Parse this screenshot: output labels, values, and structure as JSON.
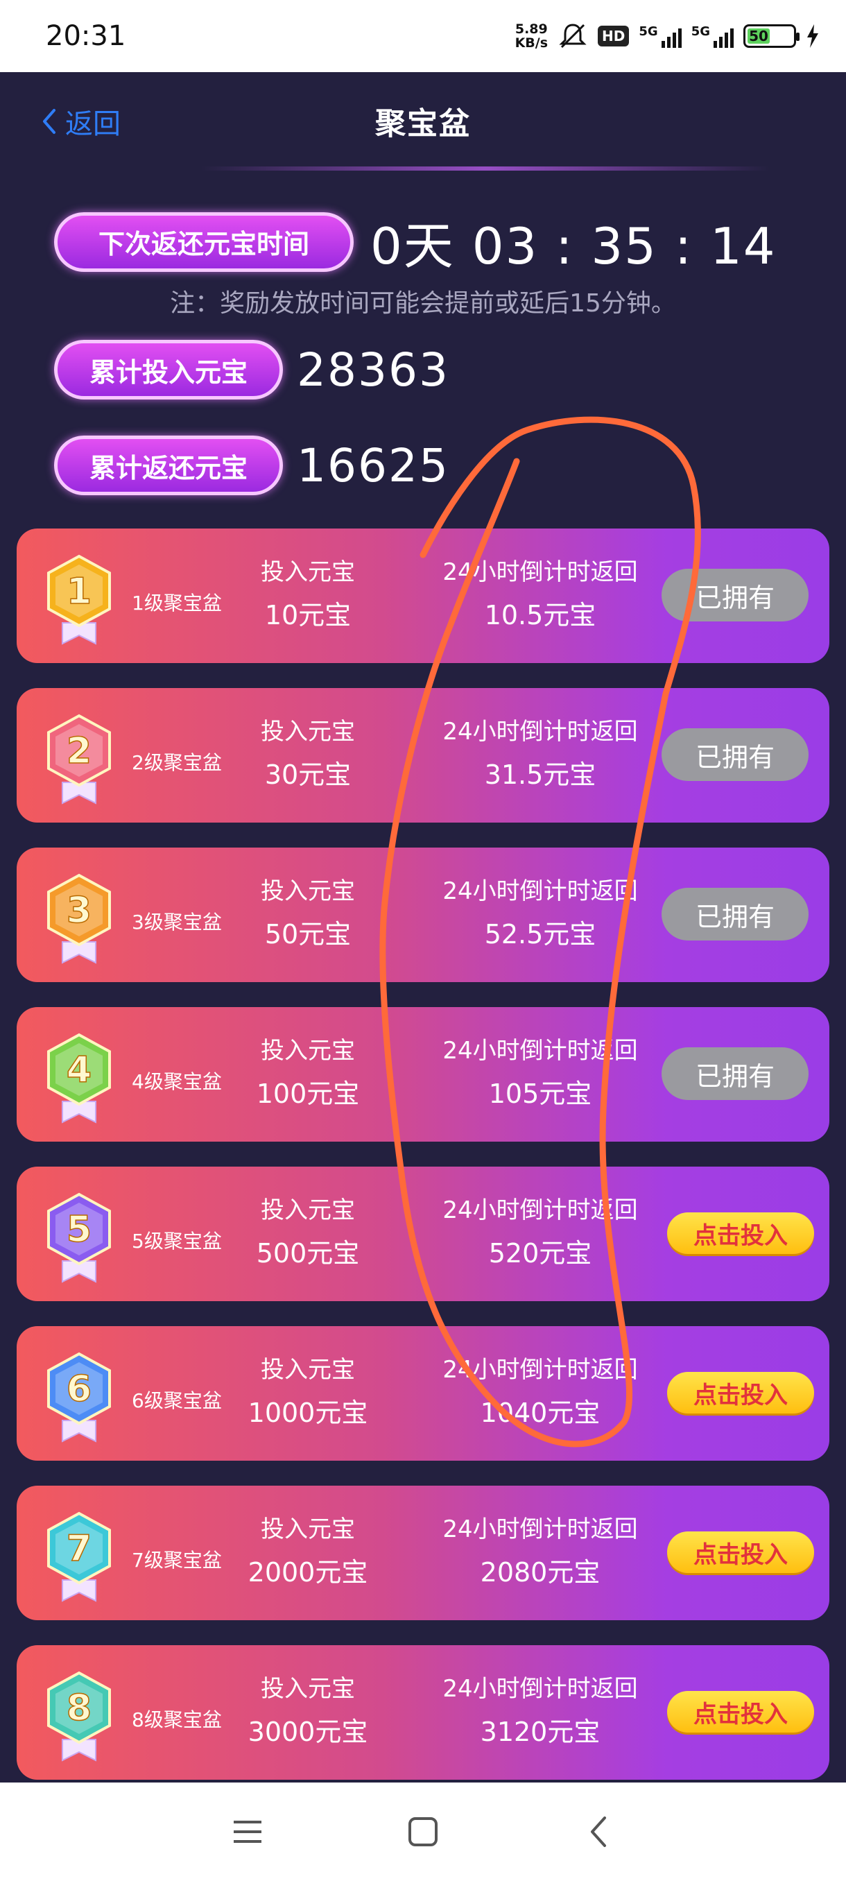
{
  "status_bar": {
    "time": "20:31",
    "net_speed_value": "5.89",
    "net_speed_unit": "KB/s",
    "hd_label": "HD",
    "signal1_label": "5G",
    "signal2_label": "5G",
    "battery_level": "50"
  },
  "header": {
    "back_label": "返回",
    "title": "聚宝盆"
  },
  "summary": {
    "next_return_label": "下次返还元宝时间",
    "countdown": "0天 03 : 35 : 14",
    "note": "注：奖励发放时间可能会提前或延后15分钟。",
    "total_invested_label": "累计投入元宝",
    "total_invested_value": "28363",
    "total_returned_label": "累计返还元宝",
    "total_returned_value": "16625"
  },
  "levels": [
    {
      "badge_number": "1",
      "name": "1级聚宝盆",
      "invest_label": "投入元宝",
      "invest_value": "10元宝",
      "return_label": "24小时倒计时返回",
      "return_value": "10.5元宝",
      "action": "已拥有",
      "owned": true
    },
    {
      "badge_number": "2",
      "name": "2级聚宝盆",
      "invest_label": "投入元宝",
      "invest_value": "30元宝",
      "return_label": "24小时倒计时返回",
      "return_value": "31.5元宝",
      "action": "已拥有",
      "owned": true
    },
    {
      "badge_number": "3",
      "name": "3级聚宝盆",
      "invest_label": "投入元宝",
      "invest_value": "50元宝",
      "return_label": "24小时倒计时返回",
      "return_value": "52.5元宝",
      "action": "已拥有",
      "owned": true
    },
    {
      "badge_number": "4",
      "name": "4级聚宝盆",
      "invest_label": "投入元宝",
      "invest_value": "100元宝",
      "return_label": "24小时倒计时返回",
      "return_value": "105元宝",
      "action": "已拥有",
      "owned": true
    },
    {
      "badge_number": "5",
      "name": "5级聚宝盆",
      "invest_label": "投入元宝",
      "invest_value": "500元宝",
      "return_label": "24小时倒计时返回",
      "return_value": "520元宝",
      "action": "点击投入",
      "owned": false
    },
    {
      "badge_number": "6",
      "name": "6级聚宝盆",
      "invest_label": "投入元宝",
      "invest_value": "1000元宝",
      "return_label": "24小时倒计时返回",
      "return_value": "1040元宝",
      "action": "点击投入",
      "owned": false
    },
    {
      "badge_number": "7",
      "name": "7级聚宝盆",
      "invest_label": "投入元宝",
      "invest_value": "2000元宝",
      "return_label": "24小时倒计时返回",
      "return_value": "2080元宝",
      "action": "点击投入",
      "owned": false
    },
    {
      "badge_number": "8",
      "name": "8级聚宝盆",
      "invest_label": "投入元宝",
      "invest_value": "3000元宝",
      "return_label": "24小时倒计时返回",
      "return_value": "3120元宝",
      "action": "点击投入",
      "owned": false
    }
  ],
  "badge_colors": [
    "#f6b21c",
    "#f0657d",
    "#f59a2a",
    "#7bd14a",
    "#8a5cf0",
    "#4d8cf5",
    "#3cc8d8",
    "#45c9b4"
  ],
  "colors": {
    "background": "#23203f",
    "accent_blue": "#2f7df6",
    "pill_purple": "#b33ee8",
    "owned_gray": "#9a9a9f",
    "invest_yellow": "#ffce1f",
    "invest_text_red": "#e2323c",
    "scribble_orange": "#ff6a3a"
  },
  "icons": {
    "back": "chevron-left-icon",
    "nav_menu": "menu-icon",
    "nav_home": "square-home-icon",
    "nav_back": "back-triangle-icon"
  }
}
